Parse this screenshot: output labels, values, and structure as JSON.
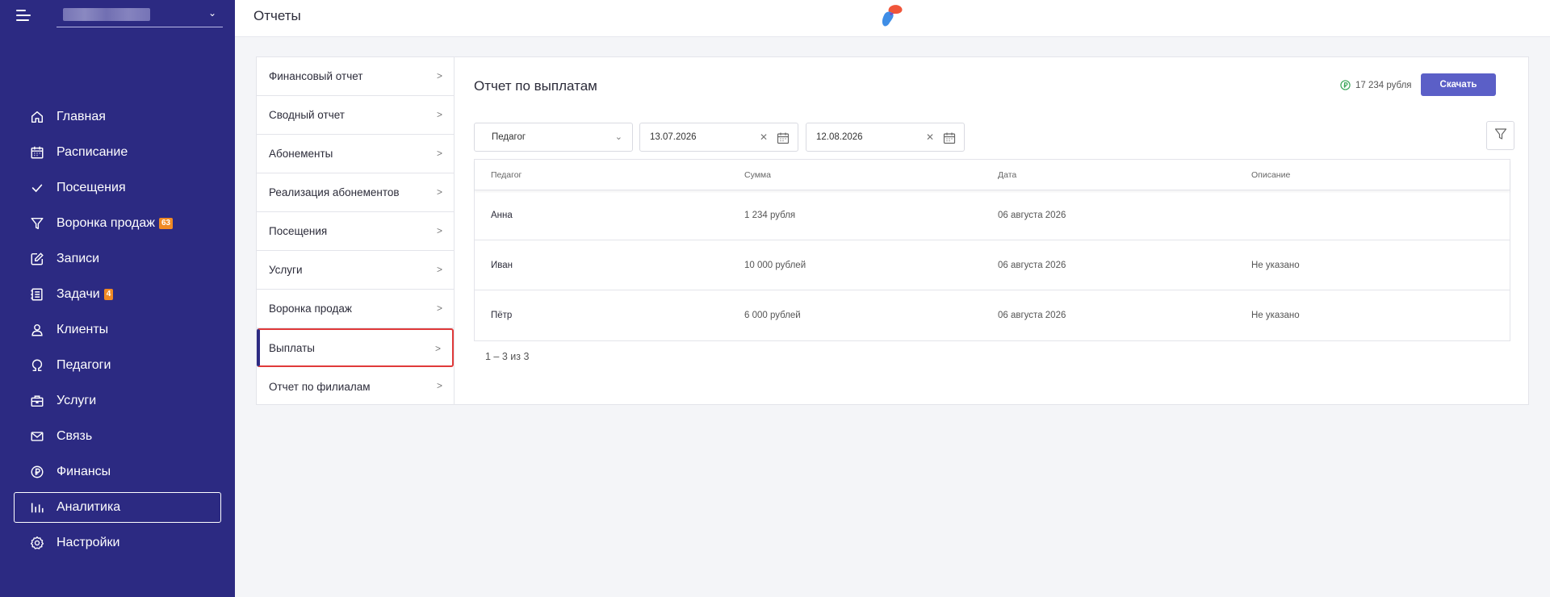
{
  "sidebar": {
    "items": [
      {
        "label": "Главная",
        "icon": "home-icon"
      },
      {
        "label": "Расписание",
        "icon": "calendar-icon"
      },
      {
        "label": "Посещения",
        "icon": "check-icon"
      },
      {
        "label": "Воронка продаж",
        "icon": "funnel-icon",
        "badge": "63"
      },
      {
        "label": "Записи",
        "icon": "edit-icon"
      },
      {
        "label": "Задачи",
        "icon": "tasks-icon",
        "badge": "4"
      },
      {
        "label": "Клиенты",
        "icon": "user-icon"
      },
      {
        "label": "Педагоги",
        "icon": "teacher-icon"
      },
      {
        "label": "Услуги",
        "icon": "briefcase-icon"
      },
      {
        "label": "Связь",
        "icon": "mail-icon"
      },
      {
        "label": "Финансы",
        "icon": "ruble-icon"
      },
      {
        "label": "Аналитика",
        "icon": "bar-chart-icon",
        "active": true
      },
      {
        "label": "Настройки",
        "icon": "settings-icon"
      }
    ],
    "badge_color": "#f08a24"
  },
  "header": {
    "title": "Отчеты"
  },
  "report_menu": {
    "items": [
      {
        "label": "Финансовый отчет"
      },
      {
        "label": "Сводный отчет"
      },
      {
        "label": "Абонементы"
      },
      {
        "label": "Реализация абонементов"
      },
      {
        "label": "Посещения"
      },
      {
        "label": "Услуги"
      },
      {
        "label": "Воронка продаж"
      },
      {
        "label": "Выплаты",
        "selected": true
      },
      {
        "label": "Отчет по филиалам"
      }
    ]
  },
  "content": {
    "title": "Отчет по выплатам",
    "total": "17 234 рубля",
    "download_label": "Скачать",
    "filters": {
      "teacher_placeholder": "Педагог",
      "date_from": "13.07.2026",
      "date_to": "12.08.2026"
    },
    "table": {
      "headers": [
        "Педагог",
        "Сумма",
        "Дата",
        "Описание"
      ],
      "rows": [
        {
          "teacher": "Анна",
          "amount": "1 234 рубля",
          "date": "06 августа 2026",
          "description": ""
        },
        {
          "teacher": "Иван",
          "amount": "10 000 рублей",
          "date": "06 августа 2026",
          "description": "Не указано"
        },
        {
          "teacher": "Пётр",
          "amount": "6 000 рублей",
          "date": "06 августа 2026",
          "description": "Не указано"
        }
      ]
    },
    "pagination": "1 – 3 из 3"
  },
  "colors": {
    "sidebar_bg": "#2c2a82",
    "accent": "#5b5fc7",
    "selected_outline": "#e03a3a"
  }
}
